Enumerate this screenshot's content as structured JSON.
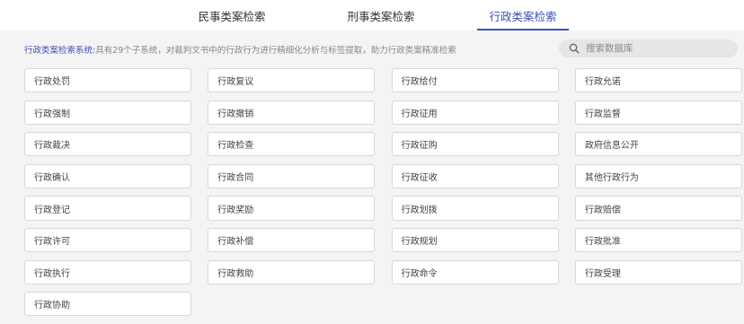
{
  "tabs": [
    {
      "label": "民事类案检索",
      "active": false
    },
    {
      "label": "刑事类案检索",
      "active": false
    },
    {
      "label": "行政类案检索",
      "active": true
    }
  ],
  "description": {
    "lead": "行政类案检索系统:",
    "text": "具有29个子系统，对裁判文书中的行政行为进行精细化分析与标签提取，助力行政类案精准检索"
  },
  "search": {
    "placeholder": "搜索数据库",
    "value": ""
  },
  "categories": [
    "行政处罚",
    "行政复议",
    "行政给付",
    "行政允诺",
    "行政强制",
    "行政撤销",
    "行政征用",
    "行政监督",
    "行政裁决",
    "行政检查",
    "行政征购",
    "政府信息公开",
    "行政确认",
    "行政合同",
    "行政征收",
    "其他行政行为",
    "行政登记",
    "行政奖励",
    "行政划拨",
    "行政赔偿",
    "行政许可",
    "行政补偿",
    "行政规划",
    "行政批准",
    "行政执行",
    "行政救助",
    "行政命令",
    "行政受理",
    "行政协助"
  ],
  "colors": {
    "accent": "#3f51b5",
    "background": "#f4f4f4"
  }
}
